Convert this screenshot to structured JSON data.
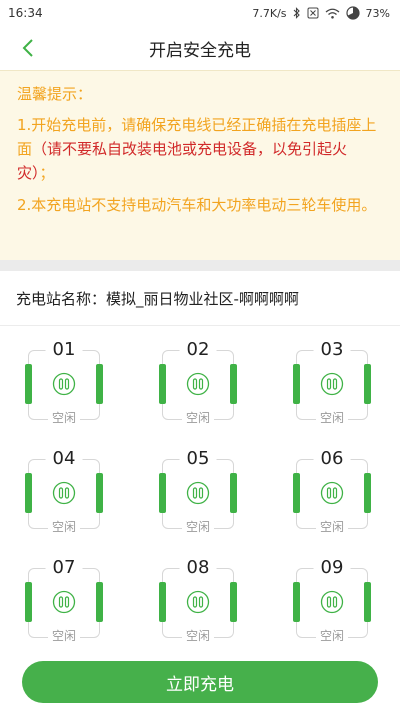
{
  "status_bar": {
    "time": "16:34",
    "net_speed": "7.7K/s",
    "battery": "73%",
    "icons": [
      "bluetooth-icon",
      "sim-off-icon",
      "wifi-icon",
      "battery-icon"
    ]
  },
  "nav": {
    "title": "开启安全充电",
    "back_icon": "chevron-left-icon"
  },
  "tips": {
    "title": "温馨提示：",
    "tip1_main": "1.开始充电前，请确保充电线已经正确插在充电插座上面",
    "tip1_warning": "（请不要私自改装电池或充电设备，以免引起火灾）",
    "tip1_end": "；",
    "tip2": "2.本充电站不支持电动汽车和大功率电动三轮车使用。"
  },
  "station": {
    "label": "充电站名称：",
    "name": "模拟_丽日物业社区-啊啊啊啊"
  },
  "ports": [
    {
      "number": "01",
      "status": "空闲"
    },
    {
      "number": "02",
      "status": "空闲"
    },
    {
      "number": "03",
      "status": "空闲"
    },
    {
      "number": "04",
      "status": "空闲"
    },
    {
      "number": "05",
      "status": "空闲"
    },
    {
      "number": "06",
      "status": "空闲"
    },
    {
      "number": "07",
      "status": "空闲"
    },
    {
      "number": "08",
      "status": "空闲"
    },
    {
      "number": "09",
      "status": "空闲"
    }
  ],
  "action": {
    "charge_label": "立即充电"
  },
  "colors": {
    "accent_green": "#46b04b",
    "tip_orange": "#f2a420",
    "warning_red": "#d12a2a",
    "tips_bg": "#fdf8e6"
  }
}
